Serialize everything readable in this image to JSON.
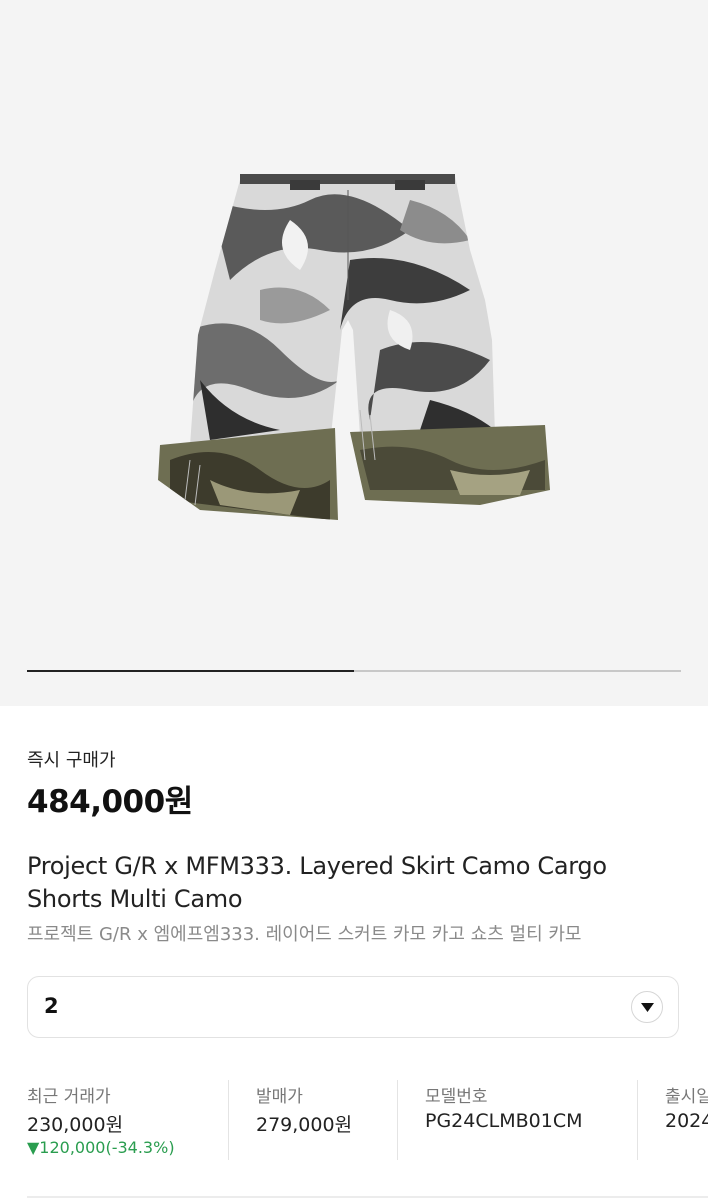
{
  "gallery": {
    "progress_fraction": 0.5
  },
  "price": {
    "label": "즉시 구매가",
    "value": "484,000원"
  },
  "product": {
    "title_en": "Project G/R x MFM333. Layered Skirt Camo Cargo Shorts Multi Camo",
    "title_ko": "프로젝트 G/R x 엠에프엠333. 레이어드 스커트 카모 카고 쇼츠 멀티 카모"
  },
  "size_select": {
    "value": "2",
    "icon": "chevron-down-icon"
  },
  "info": {
    "recent": {
      "label": "최근 거래가",
      "value": "230,000원",
      "change": "▼120,000(-34.3%)"
    },
    "release_price": {
      "label": "발매가",
      "value": "279,000원"
    },
    "model": {
      "label": "모델번호",
      "value": "PG24CLMB01CM"
    },
    "release_date": {
      "label": "출시일",
      "value": "2024"
    }
  },
  "colors": {
    "change_down": "#2a9d4f",
    "gallery_bg": "#f4f4f4"
  }
}
